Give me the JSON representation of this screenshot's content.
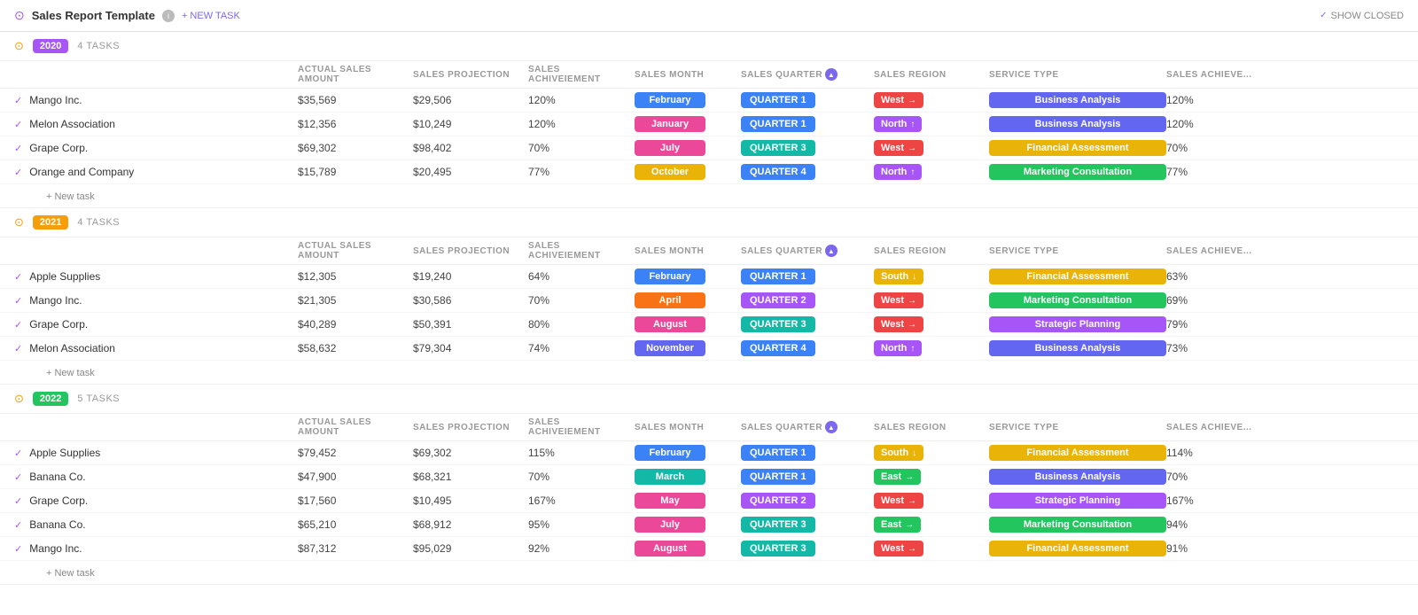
{
  "header": {
    "title": "Sales Report Template",
    "new_task_label": "+ NEW TASK",
    "show_closed_label": "SHOW CLOSED"
  },
  "columns": [
    {
      "id": "name",
      "label": ""
    },
    {
      "id": "actual_sales",
      "label": "ACTUAL SALES AMOUNT"
    },
    {
      "id": "projection",
      "label": "SALES PROJECTION"
    },
    {
      "id": "achievement",
      "label": "SALES ACHIVEIEMENT"
    },
    {
      "id": "month",
      "label": "SALES MONTH"
    },
    {
      "id": "quarter",
      "label": "SALES QUARTER",
      "sortable": true
    },
    {
      "id": "region",
      "label": "SALES REGION"
    },
    {
      "id": "service",
      "label": "SERVICE TYPE"
    },
    {
      "id": "achievement2",
      "label": "SALES ACHIEVE..."
    },
    {
      "id": "add",
      "label": ""
    }
  ],
  "groups": [
    {
      "id": "2020",
      "year": "2020",
      "badge_class": "badge-2020",
      "task_count": "4 TASKS",
      "new_task_label": "+ New task",
      "tasks": [
        {
          "name": "Mango Inc.",
          "actual_sales": "$35,569",
          "projection": "$29,506",
          "achievement": "120%",
          "month": "February",
          "month_class": "pill-blue",
          "quarter": "QUARTER 1",
          "quarter_class": "pill-blue",
          "region": "West",
          "region_class": "region-west",
          "region_icon": "→",
          "service": "Business Analysis",
          "service_class": "service-ba",
          "achievement2": "120%"
        },
        {
          "name": "Melon Association",
          "actual_sales": "$12,356",
          "projection": "$10,249",
          "achievement": "120%",
          "month": "January",
          "month_class": "pill-pink",
          "quarter": "QUARTER 1",
          "quarter_class": "pill-blue",
          "region": "North",
          "region_class": "region-north",
          "region_icon": "↑",
          "service": "Business Analysis",
          "service_class": "service-ba",
          "achievement2": "120%"
        },
        {
          "name": "Grape Corp.",
          "actual_sales": "$69,302",
          "projection": "$98,402",
          "achievement": "70%",
          "month": "July",
          "month_class": "pill-pink",
          "quarter": "QUARTER 3",
          "quarter_class": "pill-teal",
          "region": "West",
          "region_class": "region-west",
          "region_icon": "→",
          "service": "Financial Assessment",
          "service_class": "service-fa",
          "achievement2": "70%"
        },
        {
          "name": "Orange and Company",
          "actual_sales": "$15,789",
          "projection": "$20,495",
          "achievement": "77%",
          "month": "October",
          "month_class": "pill-gold",
          "quarter": "QUARTER 4",
          "quarter_class": "pill-blue",
          "region": "North",
          "region_class": "region-north",
          "region_icon": "↑",
          "service": "Marketing Consultation",
          "service_class": "service-mc",
          "achievement2": "77%"
        }
      ]
    },
    {
      "id": "2021",
      "year": "2021",
      "badge_class": "badge-2021",
      "task_count": "4 TASKS",
      "new_task_label": "+ New task",
      "tasks": [
        {
          "name": "Apple Supplies",
          "actual_sales": "$12,305",
          "projection": "$19,240",
          "achievement": "64%",
          "month": "February",
          "month_class": "pill-blue",
          "quarter": "QUARTER 1",
          "quarter_class": "pill-blue",
          "region": "South",
          "region_class": "region-south",
          "region_icon": "↓",
          "service": "Financial Assessment",
          "service_class": "service-fa",
          "achievement2": "63%"
        },
        {
          "name": "Mango Inc.",
          "actual_sales": "$21,305",
          "projection": "$30,586",
          "achievement": "70%",
          "month": "April",
          "month_class": "pill-orange",
          "quarter": "QUARTER 2",
          "quarter_class": "pill-purple",
          "region": "West",
          "region_class": "region-west",
          "region_icon": "→",
          "service": "Marketing Consultation",
          "service_class": "service-mc",
          "achievement2": "69%"
        },
        {
          "name": "Grape Corp.",
          "actual_sales": "$40,289",
          "projection": "$50,391",
          "achievement": "80%",
          "month": "August",
          "month_class": "pill-pink",
          "quarter": "QUARTER 3",
          "quarter_class": "pill-teal",
          "region": "West",
          "region_class": "region-west",
          "region_icon": "→",
          "service": "Strategic Planning",
          "service_class": "service-sp",
          "achievement2": "79%"
        },
        {
          "name": "Melon Association",
          "actual_sales": "$58,632",
          "projection": "$79,304",
          "achievement": "74%",
          "month": "November",
          "month_class": "pill-gray-blue",
          "quarter": "QUARTER 4",
          "quarter_class": "pill-blue",
          "region": "North",
          "region_class": "region-north",
          "region_icon": "↑",
          "service": "Business Analysis",
          "service_class": "service-ba",
          "achievement2": "73%"
        }
      ]
    },
    {
      "id": "2022",
      "year": "2022",
      "badge_class": "badge-2022",
      "task_count": "5 TASKS",
      "new_task_label": "+ New task",
      "tasks": [
        {
          "name": "Apple Supplies",
          "actual_sales": "$79,452",
          "projection": "$69,302",
          "achievement": "115%",
          "month": "February",
          "month_class": "pill-blue",
          "quarter": "QUARTER 1",
          "quarter_class": "pill-blue",
          "region": "South",
          "region_class": "region-south",
          "region_icon": "↓",
          "service": "Financial Assessment",
          "service_class": "service-fa",
          "achievement2": "114%"
        },
        {
          "name": "Banana Co.",
          "actual_sales": "$47,900",
          "projection": "$68,321",
          "achievement": "70%",
          "month": "March",
          "month_class": "pill-teal",
          "quarter": "QUARTER 1",
          "quarter_class": "pill-blue",
          "region": "East",
          "region_class": "region-east",
          "region_icon": "→",
          "service": "Business Analysis",
          "service_class": "service-ba",
          "achievement2": "70%"
        },
        {
          "name": "Grape Corp.",
          "actual_sales": "$17,560",
          "projection": "$10,495",
          "achievement": "167%",
          "month": "May",
          "month_class": "pill-pink",
          "quarter": "QUARTER 2",
          "quarter_class": "pill-purple",
          "region": "West",
          "region_class": "region-west",
          "region_icon": "→",
          "service": "Strategic Planning",
          "service_class": "service-sp",
          "achievement2": "167%"
        },
        {
          "name": "Banana Co.",
          "actual_sales": "$65,210",
          "projection": "$68,912",
          "achievement": "95%",
          "month": "July",
          "month_class": "pill-pink",
          "quarter": "QUARTER 3",
          "quarter_class": "pill-teal",
          "region": "East",
          "region_class": "region-east",
          "region_icon": "→",
          "service": "Marketing Consultation",
          "service_class": "service-mc",
          "achievement2": "94%"
        },
        {
          "name": "Mango Inc.",
          "actual_sales": "$87,312",
          "projection": "$95,029",
          "achievement": "92%",
          "month": "August",
          "month_class": "pill-pink",
          "quarter": "QUARTER 3",
          "quarter_class": "pill-teal",
          "region": "West",
          "region_class": "region-west",
          "region_icon": "→",
          "service": "Financial Assessment",
          "service_class": "service-fa",
          "achievement2": "91%"
        }
      ]
    }
  ]
}
